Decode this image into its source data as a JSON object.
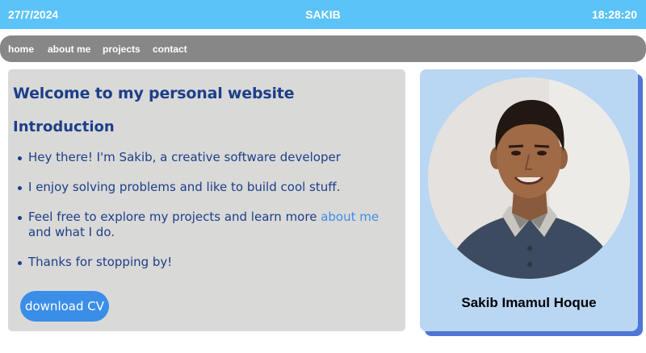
{
  "header": {
    "date": "27/7/2024",
    "title": "SAKIB",
    "time": "18:28:20"
  },
  "nav": {
    "items": [
      "home",
      "about me",
      "projects",
      "contact"
    ]
  },
  "main": {
    "welcome": "Welcome to my personal website",
    "intro_heading": "Introduction",
    "bullets": [
      {
        "text": "Hey there! I'm Sakib, a creative software developer"
      },
      {
        "text": "I enjoy solving problems and like to build cool stuff."
      },
      {
        "before": "Feel free to explore my projects and learn more ",
        "link": "about me",
        "after": " and what I do."
      },
      {
        "text": "Thanks for stopping by!"
      }
    ],
    "cv_button": "download CV"
  },
  "profile": {
    "name": "Sakib Imamul Hoque"
  },
  "colors": {
    "header_bg": "#5bc3f7",
    "nav_bg": "#878787",
    "text_blue": "#1d3e8a",
    "link_blue": "#3b8ee8",
    "profile_bg": "#b9d6f3",
    "shadow_blue": "#4f76d4"
  }
}
